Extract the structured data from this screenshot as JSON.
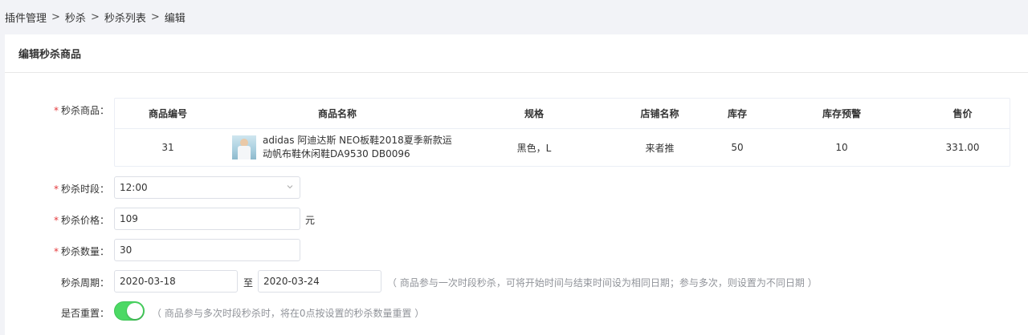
{
  "breadcrumb": [
    "插件管理",
    "秒杀",
    "秒杀列表",
    "编辑"
  ],
  "card": {
    "title": "编辑秒杀商品"
  },
  "form": {
    "product_label": "秒杀商品：",
    "time_label": "秒杀时段：",
    "time_value": "12:00",
    "price_label": "秒杀价格：",
    "price_value": "109",
    "price_unit": "元",
    "qty_label": "秒杀数量：",
    "qty_value": "30",
    "period_label": "秒杀周期：",
    "start_date": "2020-03-18",
    "to": "至",
    "end_date": "2020-03-24",
    "period_hint": "（ 商品参与一次时段秒杀，可将开始时间与结束时间设为相同日期；参与多次，则设置为不同日期 ）",
    "reset_label": "是否重置：",
    "reset_on": true,
    "reset_hint": "（ 商品参与多次时段秒杀时，将在0点按设置的秒杀数量重置 ）"
  },
  "table": {
    "headers": [
      "商品编号",
      "商品名称",
      "规格",
      "店铺名称",
      "库存",
      "库存预警",
      "售价"
    ],
    "row": {
      "id": "31",
      "name": "adidas 阿迪达斯 NEO板鞋2018夏季新款运动帆布鞋休闲鞋DA9530 DB0096",
      "spec": "黑色，L",
      "shop": "来者推",
      "stock": "50",
      "stock_warning": "10",
      "price": "331.00"
    }
  },
  "colors": {
    "required": "#e4393c",
    "switch_on": "#4cd964",
    "hint": "#909399"
  }
}
